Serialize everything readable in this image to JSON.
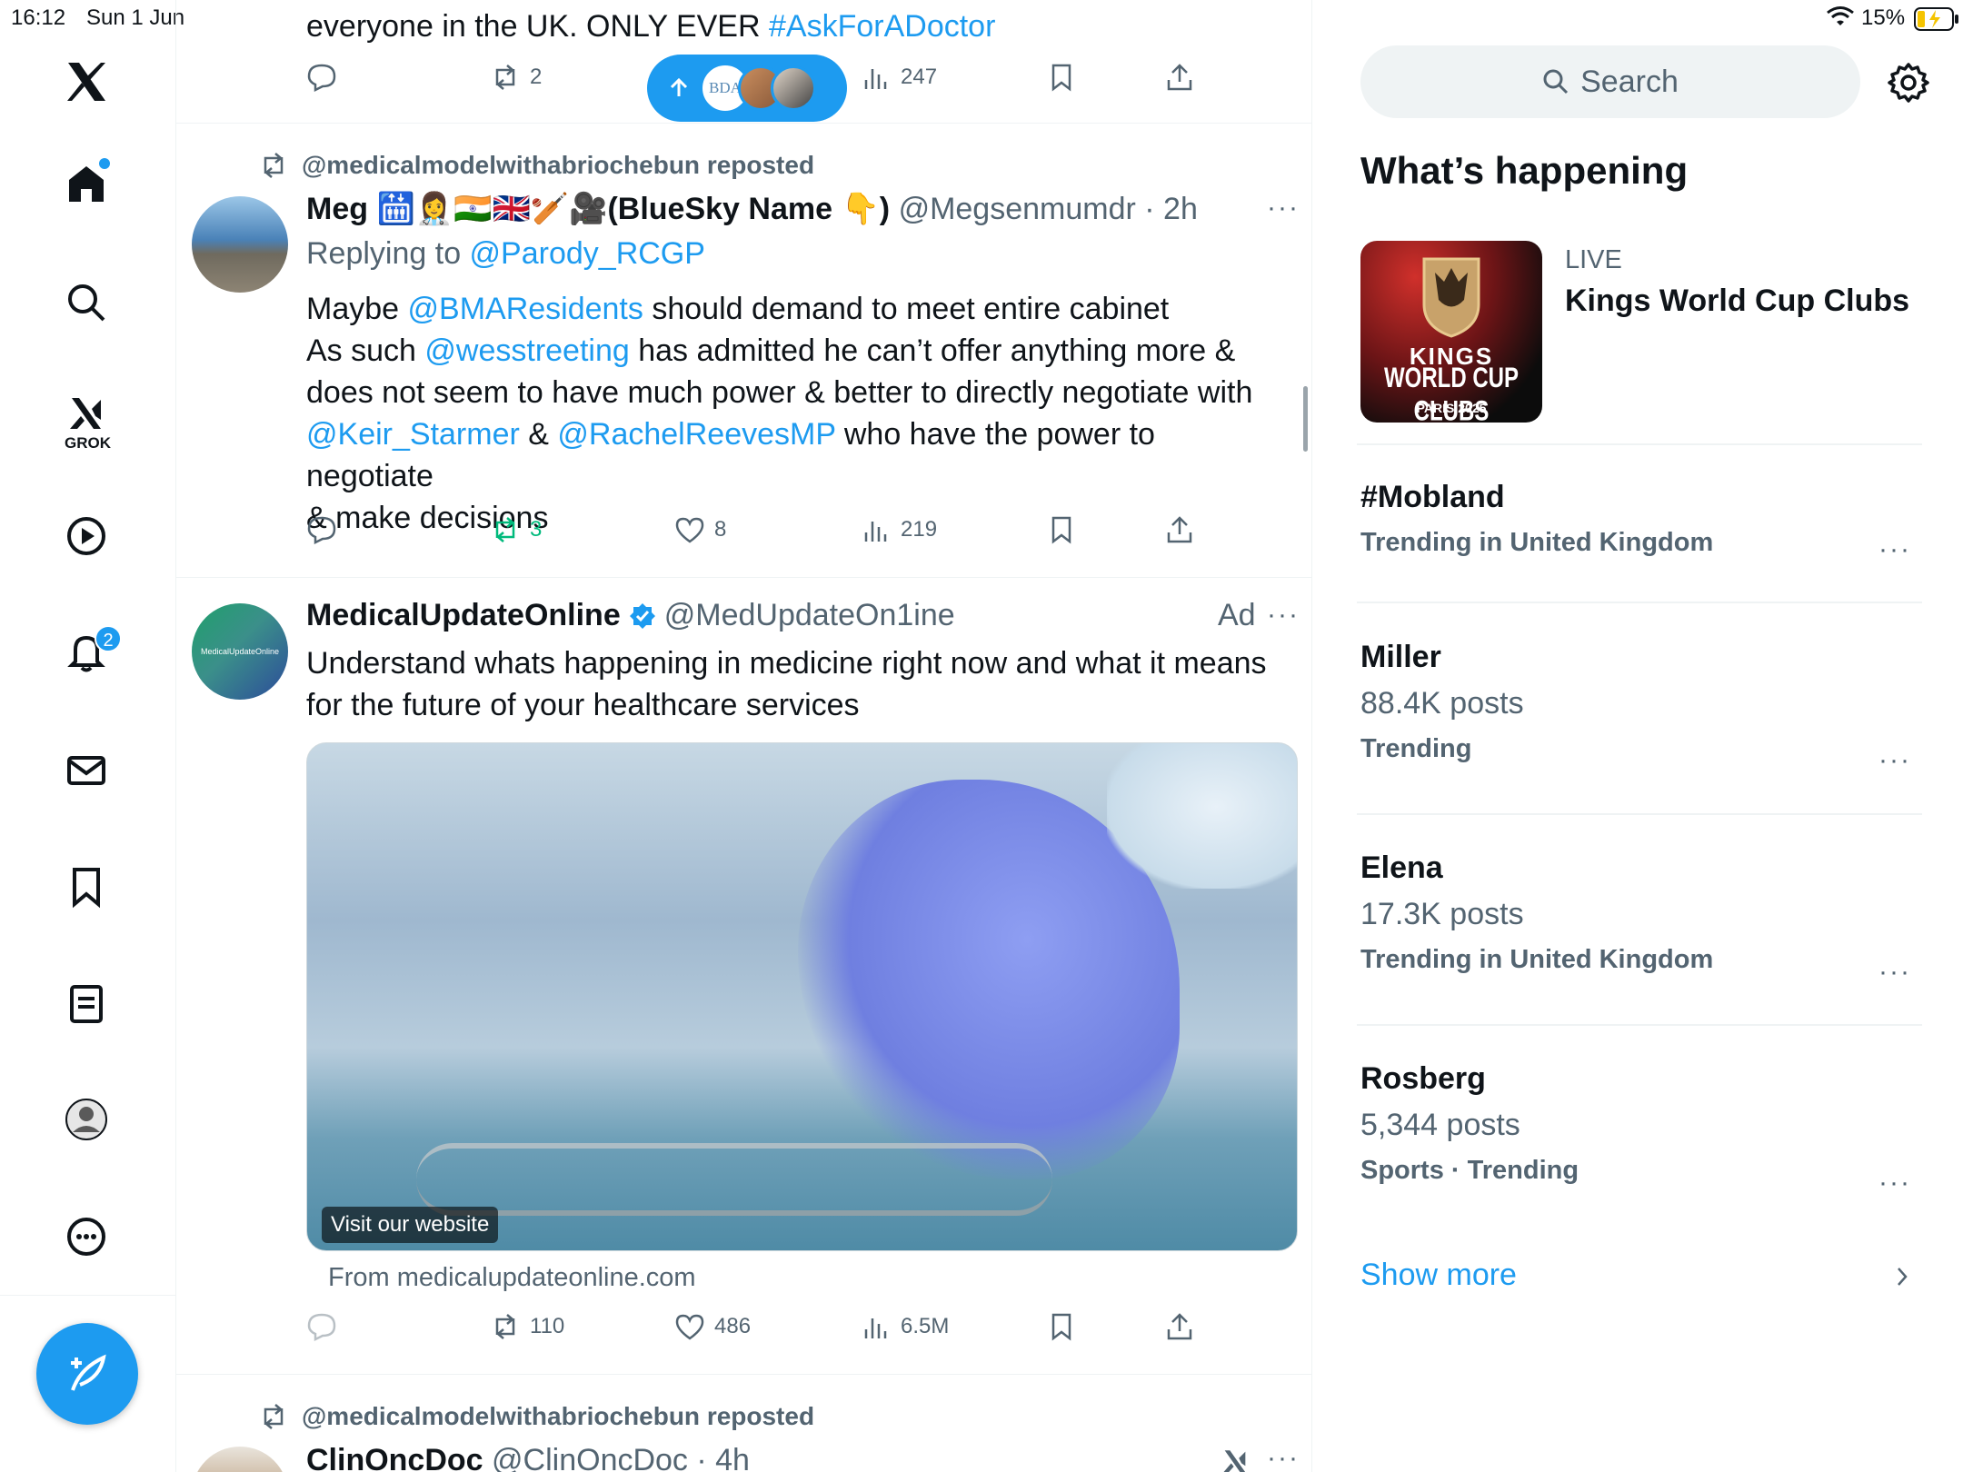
{
  "status_bar": {
    "time": "16:12",
    "date": "Sun 1 Jun",
    "battery": "15%"
  },
  "nav": {
    "items": [
      "home",
      "explore",
      "grok",
      "video",
      "notifications",
      "messages",
      "bookmarks",
      "lists",
      "profile",
      "more"
    ],
    "grok_label": "GROK",
    "notifications_count": "2"
  },
  "top_tweet": {
    "text_plain": "everyone in the UK.  ONLY EVER ",
    "hashtag": "#AskForADoctor",
    "retweets": "2",
    "views": "247",
    "new_posts_pill_label": "BDA"
  },
  "tweet1": {
    "repost_label": "@medicalmodelwithabriochebun reposted",
    "display_name": "Meg 🛗👩‍⚕️🇮🇳🇬🇧🏏🎥(BlueSky Name 👇)",
    "handle_time": "@Megsenmumdr · 2h",
    "replying_prefix": "Replying to ",
    "replying_to": "@Parody_RCGP",
    "body": [
      [
        {
          "t": "Maybe "
        },
        {
          "t": "@BMAResidents",
          "link": true
        },
        {
          "t": " should demand to meet entire cabinet"
        }
      ],
      [
        {
          "t": "As such "
        },
        {
          "t": "@wesstreeting",
          "link": true
        },
        {
          "t": " has admitted he can’t offer anything more &"
        }
      ],
      [
        {
          "t": "does not seem to have much power & better to directly negotiate with"
        }
      ],
      [
        {
          "t": "@Keir_Starmer",
          "link": true
        },
        {
          "t": " & "
        },
        {
          "t": "@RachelReevesMP",
          "link": true
        },
        {
          "t": " who have the power to negotiate"
        }
      ],
      [
        {
          "t": "& make decisions"
        }
      ]
    ],
    "retweets": "3",
    "likes": "8",
    "views": "219"
  },
  "ad": {
    "avatar_text": "MedicalUpdateOnline",
    "display_name": "MedicalUpdateOnline",
    "handle": "@MedUpdateOn1ine",
    "ad_label": "Ad",
    "body_line1": "Understand whats happening in medicine right now and what it means",
    "body_line2": "for the future of your healthcare services",
    "image_caption": "Visit our website",
    "from_label": "From medicalupdateonline.com",
    "retweets": "110",
    "likes": "486",
    "views": "6.5M"
  },
  "tweet2": {
    "repost_label": "@medicalmodelwithabriochebun reposted",
    "display_name": "ClinOncDoc",
    "handle_time": "@ClinOncDoc · 4h"
  },
  "right": {
    "search_placeholder": "Search",
    "heading": "What’s happening",
    "live": {
      "label": "LIVE",
      "title": "Kings World Cup Clubs",
      "logo_line1": "KINGS",
      "logo_line2": "WORLD CUP CLUBS",
      "logo_line3": "PARIS 2025"
    },
    "trends": [
      {
        "name": "#Mobland",
        "posts": "",
        "meta": "Trending in United Kingdom"
      },
      {
        "name": "Miller",
        "posts": "88.4K posts",
        "meta": "Trending"
      },
      {
        "name": "Elena",
        "posts": "17.3K posts",
        "meta": "Trending in United Kingdom"
      },
      {
        "name": "Rosberg",
        "posts": "5,344 posts",
        "meta": "Sports · Trending"
      }
    ],
    "show_more": "Show more"
  },
  "colors": {
    "accent": "#1d9bf0",
    "retweet_green": "#00ba7c",
    "text": "#0f1419",
    "secondary": "#536471"
  }
}
